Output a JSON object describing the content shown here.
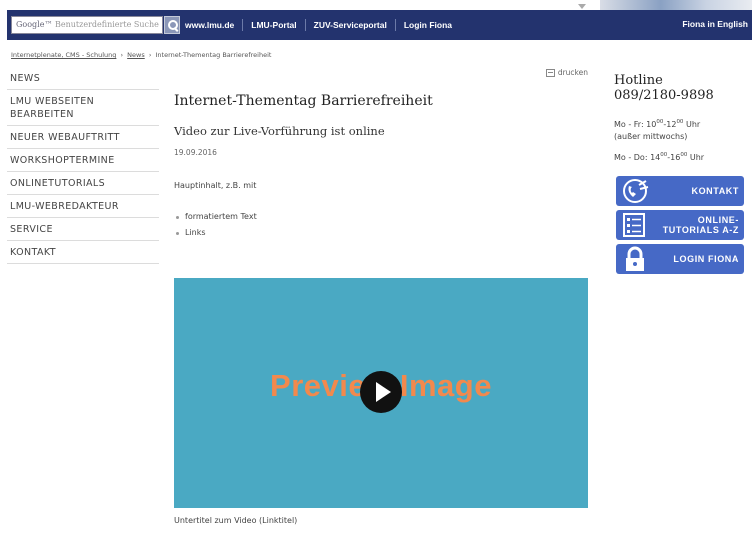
{
  "topbar": {
    "search_placeholder": "Benutzerdefinierte Suche",
    "search_brand": "Google™",
    "links": [
      "www.lmu.de",
      "LMU-Portal",
      "ZUV-Serviceportal",
      "Login Fiona"
    ],
    "english": "Fiona in English"
  },
  "breadcrumb": {
    "items": [
      "Internetplenate, CMS - Schulung",
      "News",
      "Internet-Thementag Barrierefreiheit"
    ],
    "separator": "›"
  },
  "sidebar": {
    "items": [
      {
        "label": "NEWS"
      },
      {
        "label": "LMU WEBSEITEN BEARBEITEN"
      },
      {
        "label": "NEUER WEBAUFTRITT"
      },
      {
        "label": "WORKSHOPTERMINE"
      },
      {
        "label": "ONLINETUTORIALS"
      },
      {
        "label": "LMU-WEBREDAKTEUR"
      },
      {
        "label": "SERVICE"
      },
      {
        "label": "KONTAKT"
      }
    ]
  },
  "main": {
    "print_label": "drucken",
    "title": "Internet-Thementag Barrierefreiheit",
    "subtitle": "Video zur Live-Vorführung ist online",
    "date": "19.09.2016",
    "intro": "Hauptinhalt, z.B. mit",
    "bullets": [
      "formatiertem Text",
      "Links"
    ],
    "video_text": "Preview Image",
    "caption": "Untertitel zum Video (Linktitel)"
  },
  "right": {
    "hotline_label": "Hotline",
    "hotline_number": "089/2180-9898",
    "hours": {
      "line1_prefix": "Mo - Fr: 10",
      "line1_sup1": "00",
      "line1_mid": "-12",
      "line1_sup2": "00",
      "line1_suffix": " Uhr",
      "line1_note": "(außer mittwochs)",
      "line2_prefix": "Mo - Do: 14",
      "line2_sup1": "00",
      "line2_mid": "-16",
      "line2_sup2": "00",
      "line2_suffix": " Uhr"
    },
    "buttons": [
      {
        "label": "KONTAKT",
        "icon": "phone-icon"
      },
      {
        "label": "ONLINE-TUTORIALS A-Z",
        "icon": "checklist-icon"
      },
      {
        "label": "LOGIN FIONA",
        "icon": "lock-icon"
      }
    ]
  },
  "colors": {
    "topbar": "#23336e",
    "button_blue": "#4669c6",
    "video_bg": "#4aa9c3",
    "video_text": "#f2894d"
  }
}
